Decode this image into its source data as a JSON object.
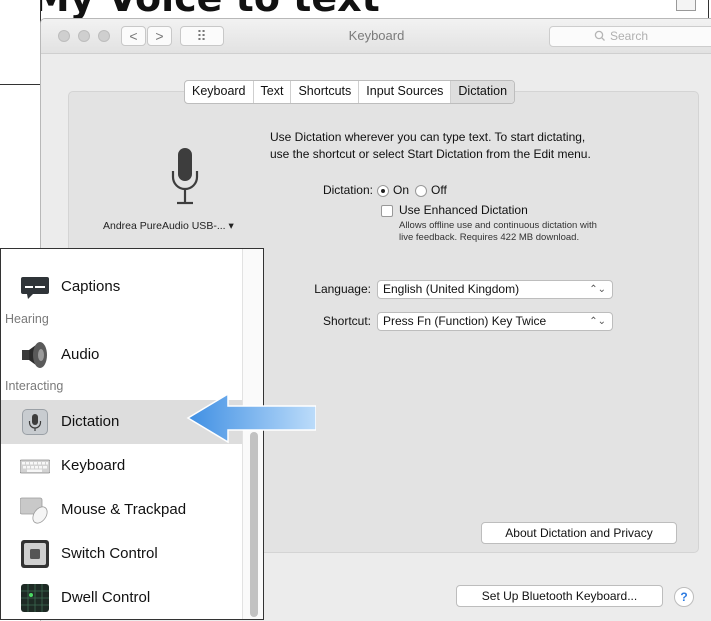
{
  "page": {
    "heading": "s My Voice to text"
  },
  "window": {
    "title": "Keyboard",
    "search_placeholder": "Search",
    "back_symbol": "<",
    "forward_symbol": ">",
    "grid_symbol": "⠿",
    "tabs": [
      {
        "label": "Keyboard",
        "active": false
      },
      {
        "label": "Text",
        "active": false
      },
      {
        "label": "Shortcuts",
        "active": false
      },
      {
        "label": "Input Sources",
        "active": false
      },
      {
        "label": "Dictation",
        "active": true
      }
    ]
  },
  "dictation": {
    "intro_line1": "Use Dictation wherever you can type text. To start dictating,",
    "intro_line2": "use the shortcut or select Start Dictation from the Edit menu.",
    "microphone_label": "Andrea PureAudio USB-...",
    "microphone_caret": "▾",
    "dictation_label": "Dictation:",
    "on_label": "On",
    "off_label": "Off",
    "selected_option": "On",
    "enhanced_label": "Use Enhanced Dictation",
    "enhanced_checked": false,
    "enhanced_note_line1": "Allows offline use and continuous dictation with",
    "enhanced_note_line2": "live feedback. Requires 422 MB download.",
    "language_label": "Language:",
    "language_value": "English (United Kingdom)",
    "shortcut_label": "Shortcut:",
    "shortcut_value": "Press Fn (Function) Key Twice",
    "select_arrows": "⌃⌄",
    "about_button": "About Dictation and Privacy",
    "bluetooth_button": "Set Up Bluetooth Keyboard...",
    "help_symbol": "?"
  },
  "accessibility_list": {
    "items": [
      {
        "kind": "item",
        "label": "Captions",
        "icon": "captions-icon"
      },
      {
        "kind": "header",
        "label": "Hearing"
      },
      {
        "kind": "item",
        "label": "Audio",
        "icon": "speaker-icon"
      },
      {
        "kind": "header",
        "label": "Interacting"
      },
      {
        "kind": "item",
        "label": "Dictation",
        "icon": "microphone-icon",
        "selected": true
      },
      {
        "kind": "item",
        "label": "Keyboard",
        "icon": "keyboard-icon"
      },
      {
        "kind": "item",
        "label": "Mouse & Trackpad",
        "icon": "mouse-icon"
      },
      {
        "kind": "item",
        "label": "Switch Control",
        "icon": "switch-control-icon"
      },
      {
        "kind": "item",
        "label": "Dwell Control",
        "icon": "dwell-control-icon"
      }
    ]
  },
  "colors": {
    "window_bg": "#ececec",
    "selection_bg": "#dddddd",
    "arrow_blue": "#4a9ae8",
    "help_blue": "#2d7be0"
  }
}
